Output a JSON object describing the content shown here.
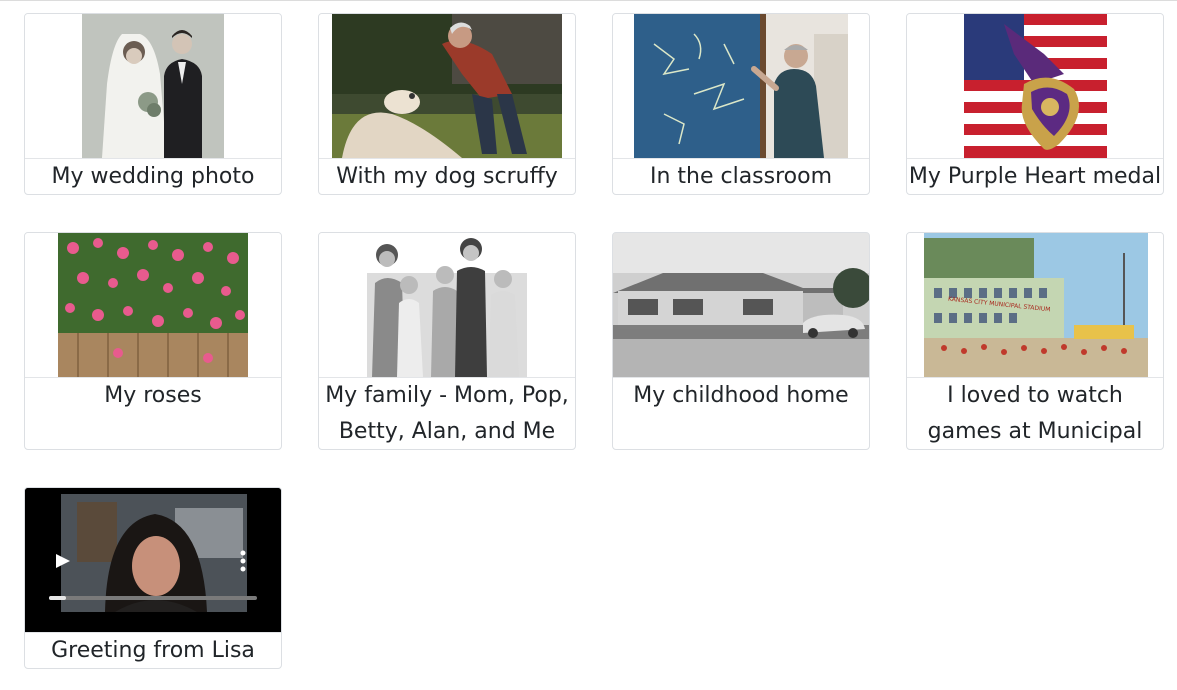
{
  "gallery": {
    "items": [
      {
        "caption": "My wedding photo"
      },
      {
        "caption": "With my dog scruffy"
      },
      {
        "caption": "In the classroom"
      },
      {
        "caption": "My Purple Heart medal"
      },
      {
        "caption": "My roses"
      },
      {
        "caption": "My family - Mom, Pop, Betty, Alan, and Me"
      },
      {
        "caption": "My childhood home"
      },
      {
        "caption": "I loved to watch games at Municipal Stadium"
      },
      {
        "caption": "Greeting from Lisa"
      }
    ],
    "video": {
      "progress_fraction": 0.08
    },
    "stadium_sign": "KANSAS CITY MUNICIPAL STADIUM"
  }
}
